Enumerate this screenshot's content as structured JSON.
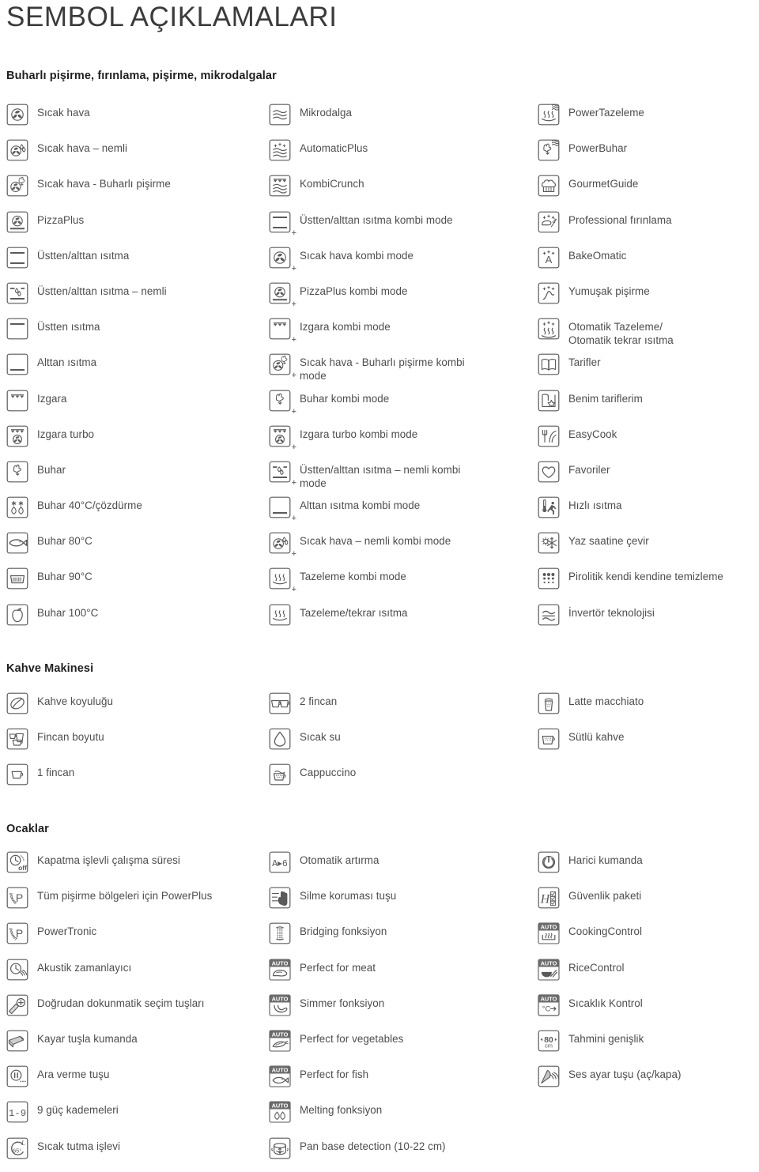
{
  "page_title": "SEMBOL AÇIKLAMALARI",
  "colors": {
    "text": "#4d4d4d",
    "title": "#3b3b3b",
    "heading": "#1f1f1f",
    "icon_stroke": "#5a5a5a",
    "auto_badge_bg": "#6b6b6b",
    "auto_badge_text": "#ffffff",
    "background": "#ffffff"
  },
  "sections": [
    {
      "title": "Buharlı pişirme, fırınlama, pişirme, mikrodalgalar",
      "columns": [
        {
          "items": [
            {
              "icon": "hot-air-icon",
              "label": "Sıcak hava"
            },
            {
              "icon": "hot-air-moist-icon",
              "label": "Sıcak hava – nemli"
            },
            {
              "icon": "hot-air-steam-icon",
              "label": "Sıcak hava - Buharlı pişirme"
            },
            {
              "icon": "pizzaplus-icon",
              "label": "PizzaPlus"
            },
            {
              "icon": "top-bottom-heat-icon",
              "label": "Üstten/alttan ısıtma"
            },
            {
              "icon": "top-bottom-heat-moist-icon",
              "label": "Üstten/alttan ısıtma – nemli"
            },
            {
              "icon": "top-heat-icon",
              "label": "Üstten ısıtma"
            },
            {
              "icon": "bottom-heat-icon",
              "label": "Alttan ısıtma"
            },
            {
              "icon": "grill-icon",
              "label": "Izgara"
            },
            {
              "icon": "grill-turbo-icon",
              "label": "Izgara turbo"
            },
            {
              "icon": "steam-icon",
              "label": "Buhar"
            },
            {
              "icon": "steam-40-defrost-icon",
              "label": "Buhar 40°C/çözdürme"
            },
            {
              "icon": "steam-80-fish-icon",
              "label": "Buhar 80°C"
            },
            {
              "icon": "steam-90-icon",
              "label": "Buhar 90°C"
            },
            {
              "icon": "steam-100-icon",
              "label": "Buhar 100°C"
            }
          ]
        },
        {
          "items": [
            {
              "icon": "microwave-icon",
              "label": "Mikrodalga"
            },
            {
              "icon": "automaticplus-icon",
              "label": "AutomaticPlus"
            },
            {
              "icon": "kombicrunch-icon",
              "label": "KombiCrunch"
            },
            {
              "icon": "top-bottom-heat-combi-icon",
              "label": "Üstten/alttan ısıtma kombi mode",
              "plus": true
            },
            {
              "icon": "hot-air-combi-icon",
              "label": "Sıcak hava kombi mode",
              "plus": true
            },
            {
              "icon": "pizzaplus-combi-icon",
              "label": "PizzaPlus kombi mode",
              "plus": true
            },
            {
              "icon": "grill-combi-icon",
              "label": "Izgara kombi mode",
              "plus": true
            },
            {
              "icon": "hot-air-steam-combi-icon",
              "label": "Sıcak hava - Buharlı pişirme kombi\nmode",
              "plus": true
            },
            {
              "icon": "steam-combi-icon",
              "label": "Buhar kombi mode",
              "plus": true
            },
            {
              "icon": "grill-turbo-combi-icon",
              "label": "Izgara turbo kombi mode",
              "plus": true
            },
            {
              "icon": "top-bottom-heat-moist-combi-icon",
              "label": "Üstten/alttan ısıtma – nemli kombi\nmode",
              "plus": true
            },
            {
              "icon": "bottom-heat-combi-icon",
              "label": "Alttan ısıtma kombi mode",
              "plus": true
            },
            {
              "icon": "hot-air-moist-combi-icon",
              "label": "Sıcak hava – nemli kombi mode",
              "plus": true
            },
            {
              "icon": "refresh-combi-icon",
              "label": "Tazeleme kombi mode",
              "plus": true
            },
            {
              "icon": "refresh-reheat-icon",
              "label": "Tazeleme/tekrar ısıtma"
            }
          ]
        },
        {
          "items": [
            {
              "icon": "powertazeleme-icon",
              "label": "PowerTazeleme"
            },
            {
              "icon": "powerbuhar-icon",
              "label": "PowerBuhar"
            },
            {
              "icon": "gourmetguide-icon",
              "label": "GourmetGuide"
            },
            {
              "icon": "professional-baking-icon",
              "label": "Professional fırınlama"
            },
            {
              "icon": "bakeomatic-icon",
              "label": "BakeOmatic"
            },
            {
              "icon": "gentle-cooking-icon",
              "label": "Yumuşak pişirme"
            },
            {
              "icon": "auto-refresh-icon",
              "label": "Otomatik Tazeleme/\nOtomatik tekrar ısıtma"
            },
            {
              "icon": "recipes-icon",
              "label": "Tarifler"
            },
            {
              "icon": "my-recipes-icon",
              "label": "Benim tariflerim"
            },
            {
              "icon": "easycook-icon",
              "label": "EasyCook"
            },
            {
              "icon": "favorites-heart-icon",
              "label": "Favoriler"
            },
            {
              "icon": "fast-heating-icon",
              "label": "Hızlı ısıtma"
            },
            {
              "icon": "summer-time-icon",
              "label": "Yaz saatine çevir"
            },
            {
              "icon": "pyrolytic-clean-icon",
              "label": "Pirolitik kendi kendine temizleme"
            },
            {
              "icon": "inverter-tech-icon",
              "label": "İnvertör teknolojisi"
            }
          ]
        }
      ]
    },
    {
      "title": "Kahve Makinesi",
      "columns": [
        {
          "items": [
            {
              "icon": "coffee-bean-icon",
              "label": "Kahve koyuluğu"
            },
            {
              "icon": "cup-size-icon",
              "label": "Fincan boyutu"
            },
            {
              "icon": "one-cup-icon",
              "label": "1 fincan"
            }
          ]
        },
        {
          "items": [
            {
              "icon": "two-cups-icon",
              "label": "2 fincan"
            },
            {
              "icon": "hot-water-drop-icon",
              "label": "Sıcak su"
            },
            {
              "icon": "cappuccino-icon",
              "label": "Cappuccino"
            }
          ]
        },
        {
          "items": [
            {
              "icon": "latte-macchiato-icon",
              "label": "Latte macchiato"
            },
            {
              "icon": "milk-coffee-icon",
              "label": "Sütlü kahve"
            }
          ]
        }
      ]
    },
    {
      "title": "Ocaklar",
      "columns": [
        {
          "items": [
            {
              "icon": "timer-off-icon",
              "label": "Kapatma işlevli çalışma süresi"
            },
            {
              "icon": "powerplus-icon",
              "label": "Tüm pişirme bölgeleri için PowerPlus"
            },
            {
              "icon": "powertronic-icon",
              "label": "PowerTronic"
            },
            {
              "icon": "acoustic-timer-icon",
              "label": "Akustik zamanlayıcı"
            },
            {
              "icon": "direct-select-icon",
              "label": "Doğrudan dokunmatik seçim tuşları"
            },
            {
              "icon": "slider-control-icon",
              "label": "Kayar tuşla kumanda"
            },
            {
              "icon": "pause-button-icon",
              "label": "Ara verme tuşu"
            },
            {
              "icon": "nine-power-levels-icon",
              "label": "9 güç kademeleri"
            },
            {
              "icon": "keep-warm-icon",
              "label": "Sıcak tutma işlevi"
            }
          ]
        },
        {
          "items": [
            {
              "icon": "auto-boost-icon",
              "label": "Otomatik artırma"
            },
            {
              "icon": "wipe-protection-icon",
              "label": "Silme koruması tuşu"
            },
            {
              "icon": "bridging-icon",
              "label": "Bridging fonksiyon"
            },
            {
              "icon": "perfect-meat-icon",
              "label": "Perfect for meat",
              "auto": true
            },
            {
              "icon": "simmer-icon",
              "label": "Simmer fonksiyon",
              "auto": true
            },
            {
              "icon": "perfect-vegetables-icon",
              "label": "Perfect for vegetables",
              "auto": true
            },
            {
              "icon": "perfect-fish-icon",
              "label": "Perfect for fish",
              "auto": true
            },
            {
              "icon": "melting-icon",
              "label": "Melting fonksiyon",
              "auto": true
            },
            {
              "icon": "pan-base-detection-icon",
              "label": "Pan base detection (10-22 cm)"
            }
          ]
        },
        {
          "items": [
            {
              "icon": "external-control-icon",
              "label": "Harici kumanda"
            },
            {
              "icon": "safety-package-icon",
              "label": "Güvenlik paketi"
            },
            {
              "icon": "cookingcontrol-icon",
              "label": "CookingControl",
              "auto": true
            },
            {
              "icon": "ricecontrol-icon",
              "label": "RiceControl",
              "auto": true
            },
            {
              "icon": "temperature-control-icon",
              "label": "Sıcaklık Kontrol",
              "auto": true
            },
            {
              "icon": "estimated-width-icon",
              "label": "Tahmini genişlik"
            },
            {
              "icon": "sound-toggle-icon",
              "label": "Ses ayar tuşu (aç/kapa)"
            }
          ]
        }
      ]
    }
  ]
}
